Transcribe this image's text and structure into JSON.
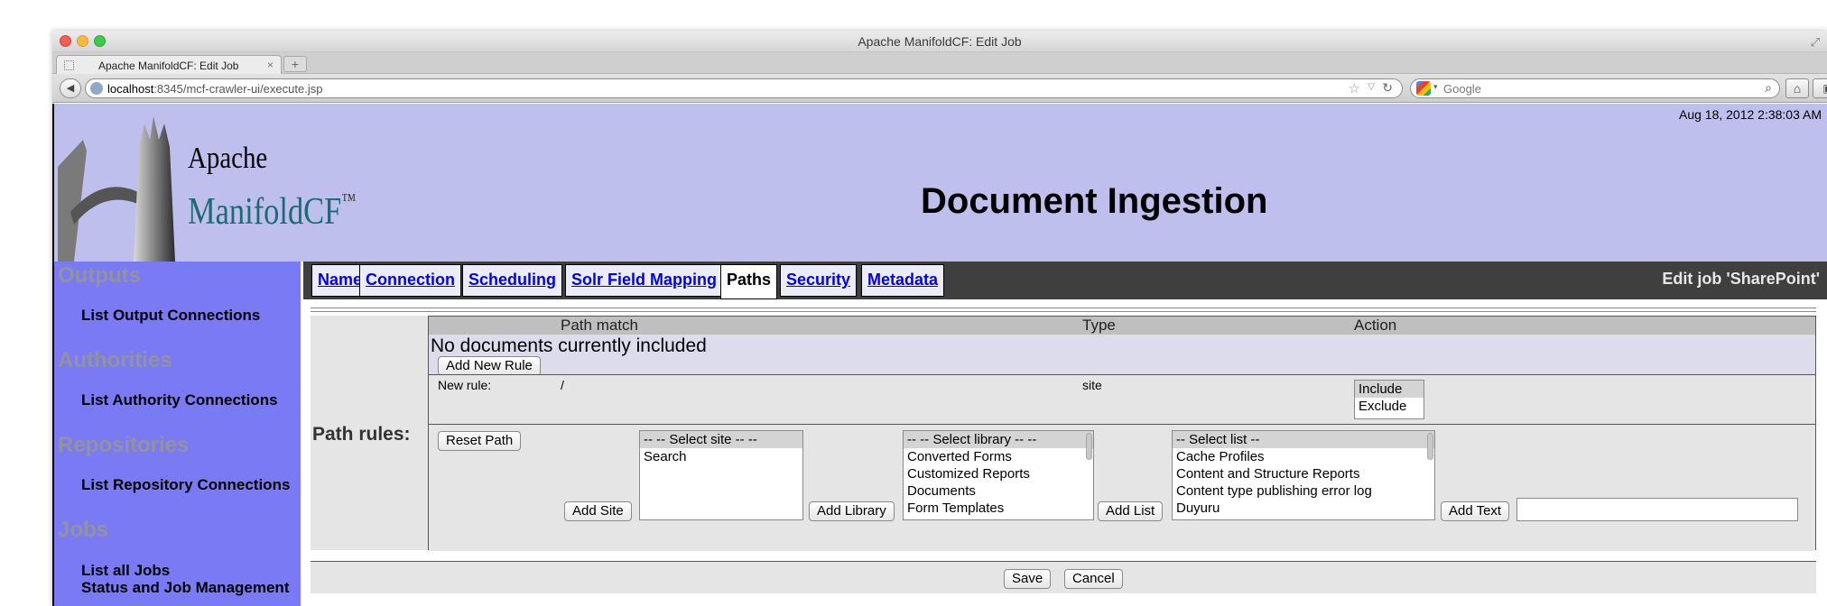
{
  "browser": {
    "window_title": "Apache ManifoldCF: Edit Job",
    "tab_title": "Apache ManifoldCF: Edit Job",
    "url_host": "localhost",
    "url_rest": ":8345/mcf-crawler-ui/execute.jsp",
    "search_placeholder": "Google",
    "icons": {
      "close": "close-dot",
      "minimize": "minimize-dot",
      "zoom": "zoom-dot",
      "back": "back-arrow-icon",
      "star": "star-icon",
      "reload": "reload-icon",
      "search": "magnifier-icon",
      "home": "home-icon",
      "menu": "menu-icon"
    }
  },
  "header": {
    "logo_line1": "Apache",
    "logo_line2": "ManifoldCF",
    "logo_tm": "™",
    "timestamp": "Aug 18, 2012 2:38:03 AM",
    "page_title": "Document Ingestion"
  },
  "sidebar": {
    "sections": [
      {
        "title": "Outputs",
        "links": [
          "List Output Connections"
        ]
      },
      {
        "title": "Authorities",
        "links": [
          "List Authority Connections"
        ]
      },
      {
        "title": "Repositories",
        "links": [
          "List Repository Connections"
        ]
      },
      {
        "title": "Jobs",
        "links": [
          "List all Jobs",
          "Status and Job Management"
        ]
      }
    ]
  },
  "tabs": [
    "Name",
    "Connection",
    "Scheduling",
    "Solr Field Mapping",
    "Paths",
    "Security",
    "Metadata"
  ],
  "active_tab": "Paths",
  "edit_title": "Edit job 'SharePoint'",
  "path_rules": {
    "label": "Path rules:",
    "columns": [
      "Path match",
      "Type",
      "Action"
    ],
    "empty_message": "No documents currently included",
    "add_new_rule": "Add New Rule",
    "new_rule_label": "New rule:",
    "new_rule_path": "/",
    "new_rule_type": "site",
    "action_options": [
      "Include",
      "Exclude"
    ],
    "reset_path": "Reset Path",
    "site_options": [
      "-- -- Select site -- --",
      "Search"
    ],
    "add_site": "Add Site",
    "library_options": [
      "-- -- Select library -- --",
      "Converted Forms",
      "Customized Reports",
      "Documents",
      "Form Templates"
    ],
    "add_library": "Add Library",
    "list_options": [
      "-- Select list --",
      "Cache Profiles",
      "Content and Structure Reports",
      "Content type publishing error log",
      "Duyuru"
    ],
    "add_list": "Add List",
    "add_text": "Add Text",
    "text_value": ""
  },
  "buttons": {
    "save": "Save",
    "cancel": "Cancel"
  },
  "colors": {
    "banner": "#bfbfed",
    "sidebar": "#7a7af5",
    "tab_strip": "#3f3f3f",
    "link": "#0000ee"
  }
}
